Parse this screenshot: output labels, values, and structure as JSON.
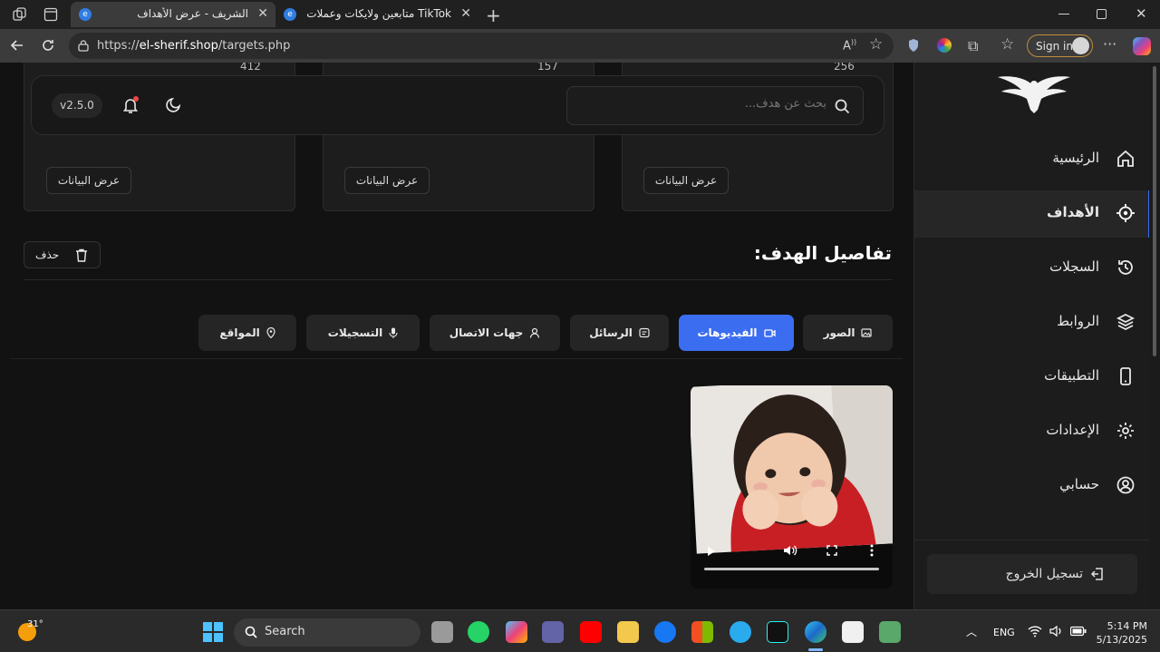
{
  "browser": {
    "tabs": [
      {
        "title": "الشريف - عرض الأهداف",
        "active": true
      },
      {
        "title": "TikTok متابعين ولايكات وعملات مجاناً",
        "active": false
      }
    ],
    "url_prefix": "https://",
    "url_domain": "el-sherif.shop",
    "url_path": "/targets.php",
    "sign_in_label": "Sign in"
  },
  "cards": [
    {
      "count": "412",
      "button": "عرض البيانات"
    },
    {
      "count": "157",
      "button": "عرض البيانات"
    },
    {
      "count": "256",
      "button": "عرض البيانات"
    }
  ],
  "topbar": {
    "search_placeholder": "بحث عن هدف...",
    "version": "v2.5.0"
  },
  "details": {
    "title": "تفاصيل الهدف:",
    "delete_label": "حذف"
  },
  "tabs": [
    {
      "label": "الصور",
      "icon": "image-icon"
    },
    {
      "label": "الفيديوهات",
      "icon": "video-icon",
      "active": true
    },
    {
      "label": "الرسائل",
      "icon": "message-icon"
    },
    {
      "label": "جهات الاتصال",
      "icon": "contact-icon"
    },
    {
      "label": "التسجيلات",
      "icon": "mic-icon"
    },
    {
      "label": "المواقع",
      "icon": "location-icon"
    }
  ],
  "sidebar": {
    "items": [
      {
        "label": "الرئيسية",
        "icon": "home-icon"
      },
      {
        "label": "الأهداف",
        "icon": "target-icon",
        "active": true
      },
      {
        "label": "السجلات",
        "icon": "history-icon"
      },
      {
        "label": "الروابط",
        "icon": "layers-icon"
      },
      {
        "label": "التطبيقات",
        "icon": "phone-icon"
      },
      {
        "label": "الإعدادات",
        "icon": "gear-icon"
      },
      {
        "label": "حسابي",
        "icon": "user-circle-icon"
      }
    ],
    "logout_label": "تسجيل الخروج"
  },
  "taskbar": {
    "weather": "31°",
    "search_label": "Search",
    "language": "ENG",
    "time": "5:14 PM",
    "date": "5/13/2025"
  },
  "colors": {
    "accent": "#3b6df0",
    "background": "#121212",
    "sidebar": "#1c1c1c"
  }
}
